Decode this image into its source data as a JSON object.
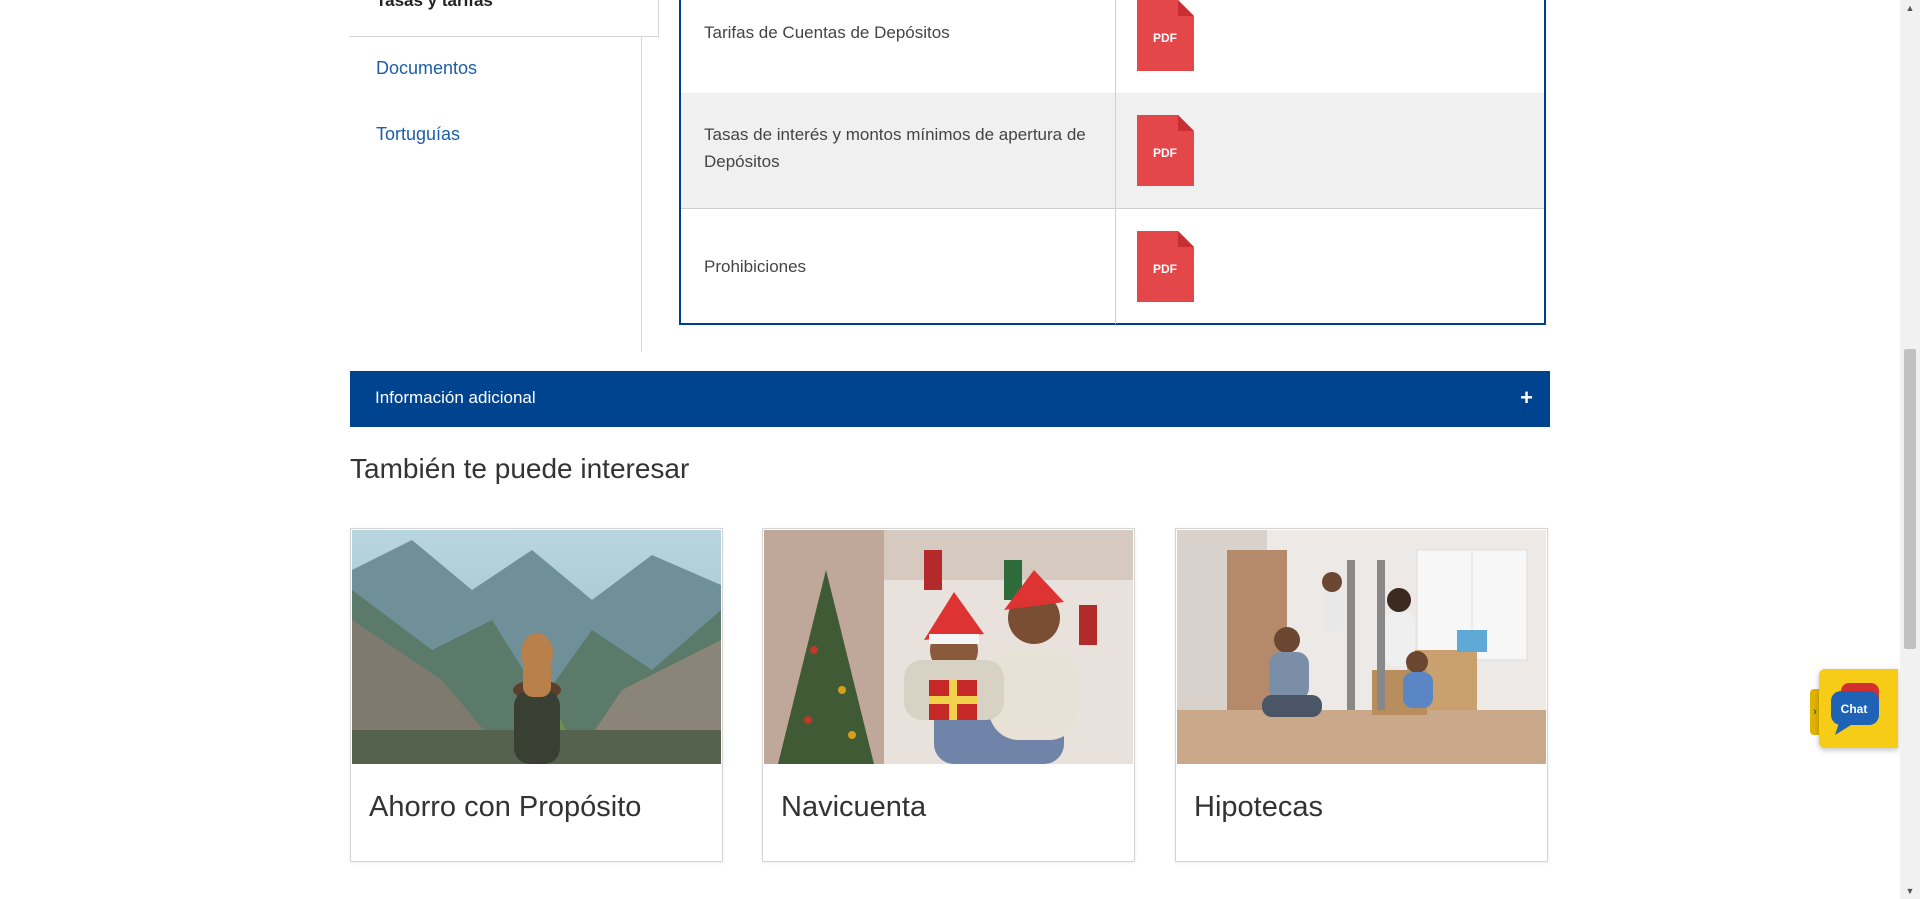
{
  "sidebar": {
    "active_item": "Tasas y tarifas",
    "items": [
      {
        "label": "Documentos"
      },
      {
        "label": "Tortuguías"
      }
    ]
  },
  "documents": {
    "rows": [
      {
        "label": "Tarifas de Cuentas de Depósitos",
        "file_type": "PDF"
      },
      {
        "label": "Tasas de interés y montos mínimos de apertura de Depósitos",
        "file_type": "PDF"
      },
      {
        "label": "Prohibiciones",
        "file_type": "PDF"
      }
    ]
  },
  "accordion": {
    "label": "Información adicional",
    "toggle_icon": "plus-icon"
  },
  "related": {
    "title": "También te puede interesar",
    "cards": [
      {
        "title": "Ahorro con Propósito",
        "image": "mountain-valley-photo"
      },
      {
        "title": "Navicuenta",
        "image": "christmas-gift-photo"
      },
      {
        "title": "Hipotecas",
        "image": "family-moving-house-photo"
      }
    ]
  },
  "chat": {
    "label": "Chat",
    "collapse_arrow": "›"
  },
  "scrollbar": {
    "up_arrow": "▲",
    "down_arrow": "▼"
  },
  "colors": {
    "brand_blue": "#00448f",
    "link_blue": "#1d5ea8",
    "pdf_red": "#e3474a",
    "chat_yellow": "#f7cc17"
  }
}
